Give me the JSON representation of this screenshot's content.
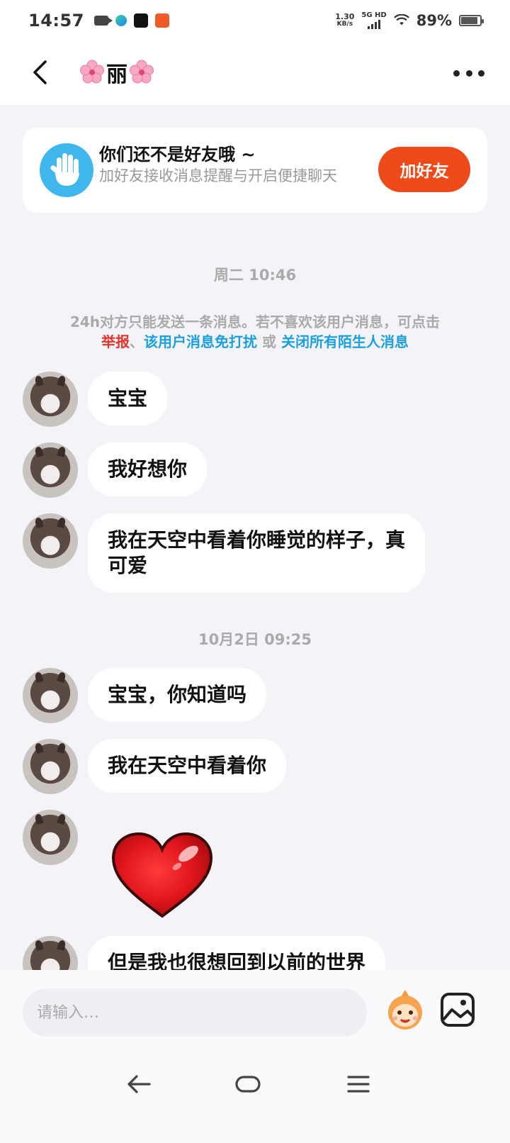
{
  "status_bar": {
    "time": "14:57",
    "net_speed_value": "1.30",
    "net_speed_unit": "KB/s",
    "net_tag": "5G HD",
    "battery": "89%",
    "battery_level": 0.89
  },
  "header": {
    "title": "丽"
  },
  "friend_banner": {
    "title": "你们还不是好友哦 ~",
    "subtitle": "加好友接收消息提醒与开启便捷聊天",
    "button": "加好友"
  },
  "timestamps": [
    "周二 10:46",
    "10月2日 09:25"
  ],
  "notice": {
    "text": "24h对方只能发送一条消息。若不喜欢该用户消息，可点击",
    "report": "举报",
    "sep": "、",
    "mute_user": "该用户消息免打扰",
    "or": " 或 ",
    "close_all": "关闭所有陌生人消息"
  },
  "messages": [
    "宝宝",
    "我好想你",
    "我在天空中看着你睡觉的样子，真可爱",
    "宝宝，你知道吗",
    "我在天空中看着你",
    "但是我也很想回到以前的世界"
  ],
  "input": {
    "placeholder": "请输入…"
  },
  "colors": {
    "accent": "#ef4a1a",
    "link_red": "#e8322d",
    "link_blue": "#1a9fe0",
    "background": "#f4f4f8"
  }
}
